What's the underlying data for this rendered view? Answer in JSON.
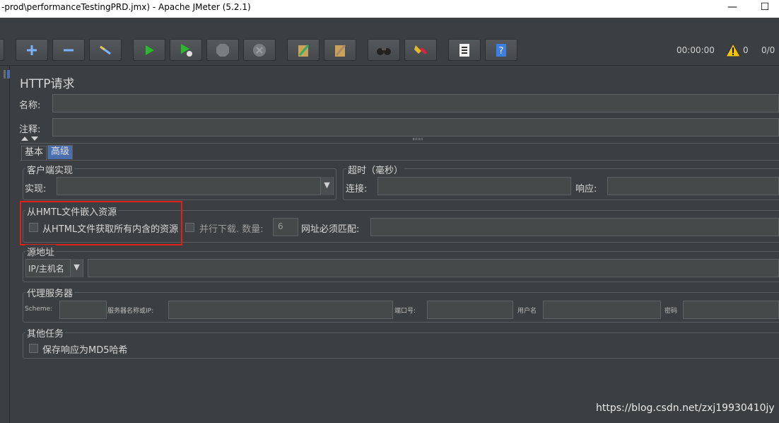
{
  "window": {
    "title": "-prod\\performanceTestingPRD.jmx) - Apache JMeter (5.2.1)",
    "minimize": "—",
    "maximize": "☐"
  },
  "toolbar": {
    "icons": [
      "add-icon",
      "remove-icon",
      "toggle-icon",
      "start-icon",
      "start-no-pause-icon",
      "stop-icon",
      "shutdown-icon",
      "clear-icon",
      "clear-all-icon",
      "search-icon",
      "reset-search-icon",
      "function-helper-icon",
      "help-icon"
    ],
    "timer": "00:00:00",
    "warnings": "0",
    "threads": "0/0"
  },
  "panel": {
    "title": "HTTP请求",
    "name_label": "名称:",
    "comment_label": "注释:",
    "name_value": "",
    "comment_value": ""
  },
  "tabs": [
    {
      "label": "基本",
      "active": false
    },
    {
      "label": "高级",
      "active": true
    }
  ],
  "client": {
    "legend": "客户端实现",
    "impl_label": "实现:",
    "impl_value": ""
  },
  "timeout": {
    "legend": "超时（毫秒）",
    "connect_label": "连接:",
    "response_label": "响应:",
    "connect_value": "",
    "response_value": ""
  },
  "embedded": {
    "legend": "从HMTL文件嵌入资源",
    "retrieve_label": "从HTML文件获取所有内含的资源",
    "parallel_label": "并行下载. 数量:",
    "parallel_value": "6",
    "url_match_label": "网址必须匹配:",
    "url_match_value": ""
  },
  "source": {
    "legend": "源地址",
    "type_value": "IP/主机名",
    "address_value": ""
  },
  "proxy": {
    "legend": "代理服务器",
    "scheme_label": "Scheme:",
    "server_label": "服务器名称或IP:",
    "port_label": "端口号:",
    "user_label": "用户名",
    "password_label": "密码"
  },
  "other": {
    "legend": "其他任务",
    "md5_label": "保存响应为MD5哈希"
  },
  "watermark": "https://blog.csdn.net/zxj19930410jy",
  "colors": {
    "background": "#3c3f41",
    "highlight": "#e0201a",
    "play": "#2fb52f"
  }
}
